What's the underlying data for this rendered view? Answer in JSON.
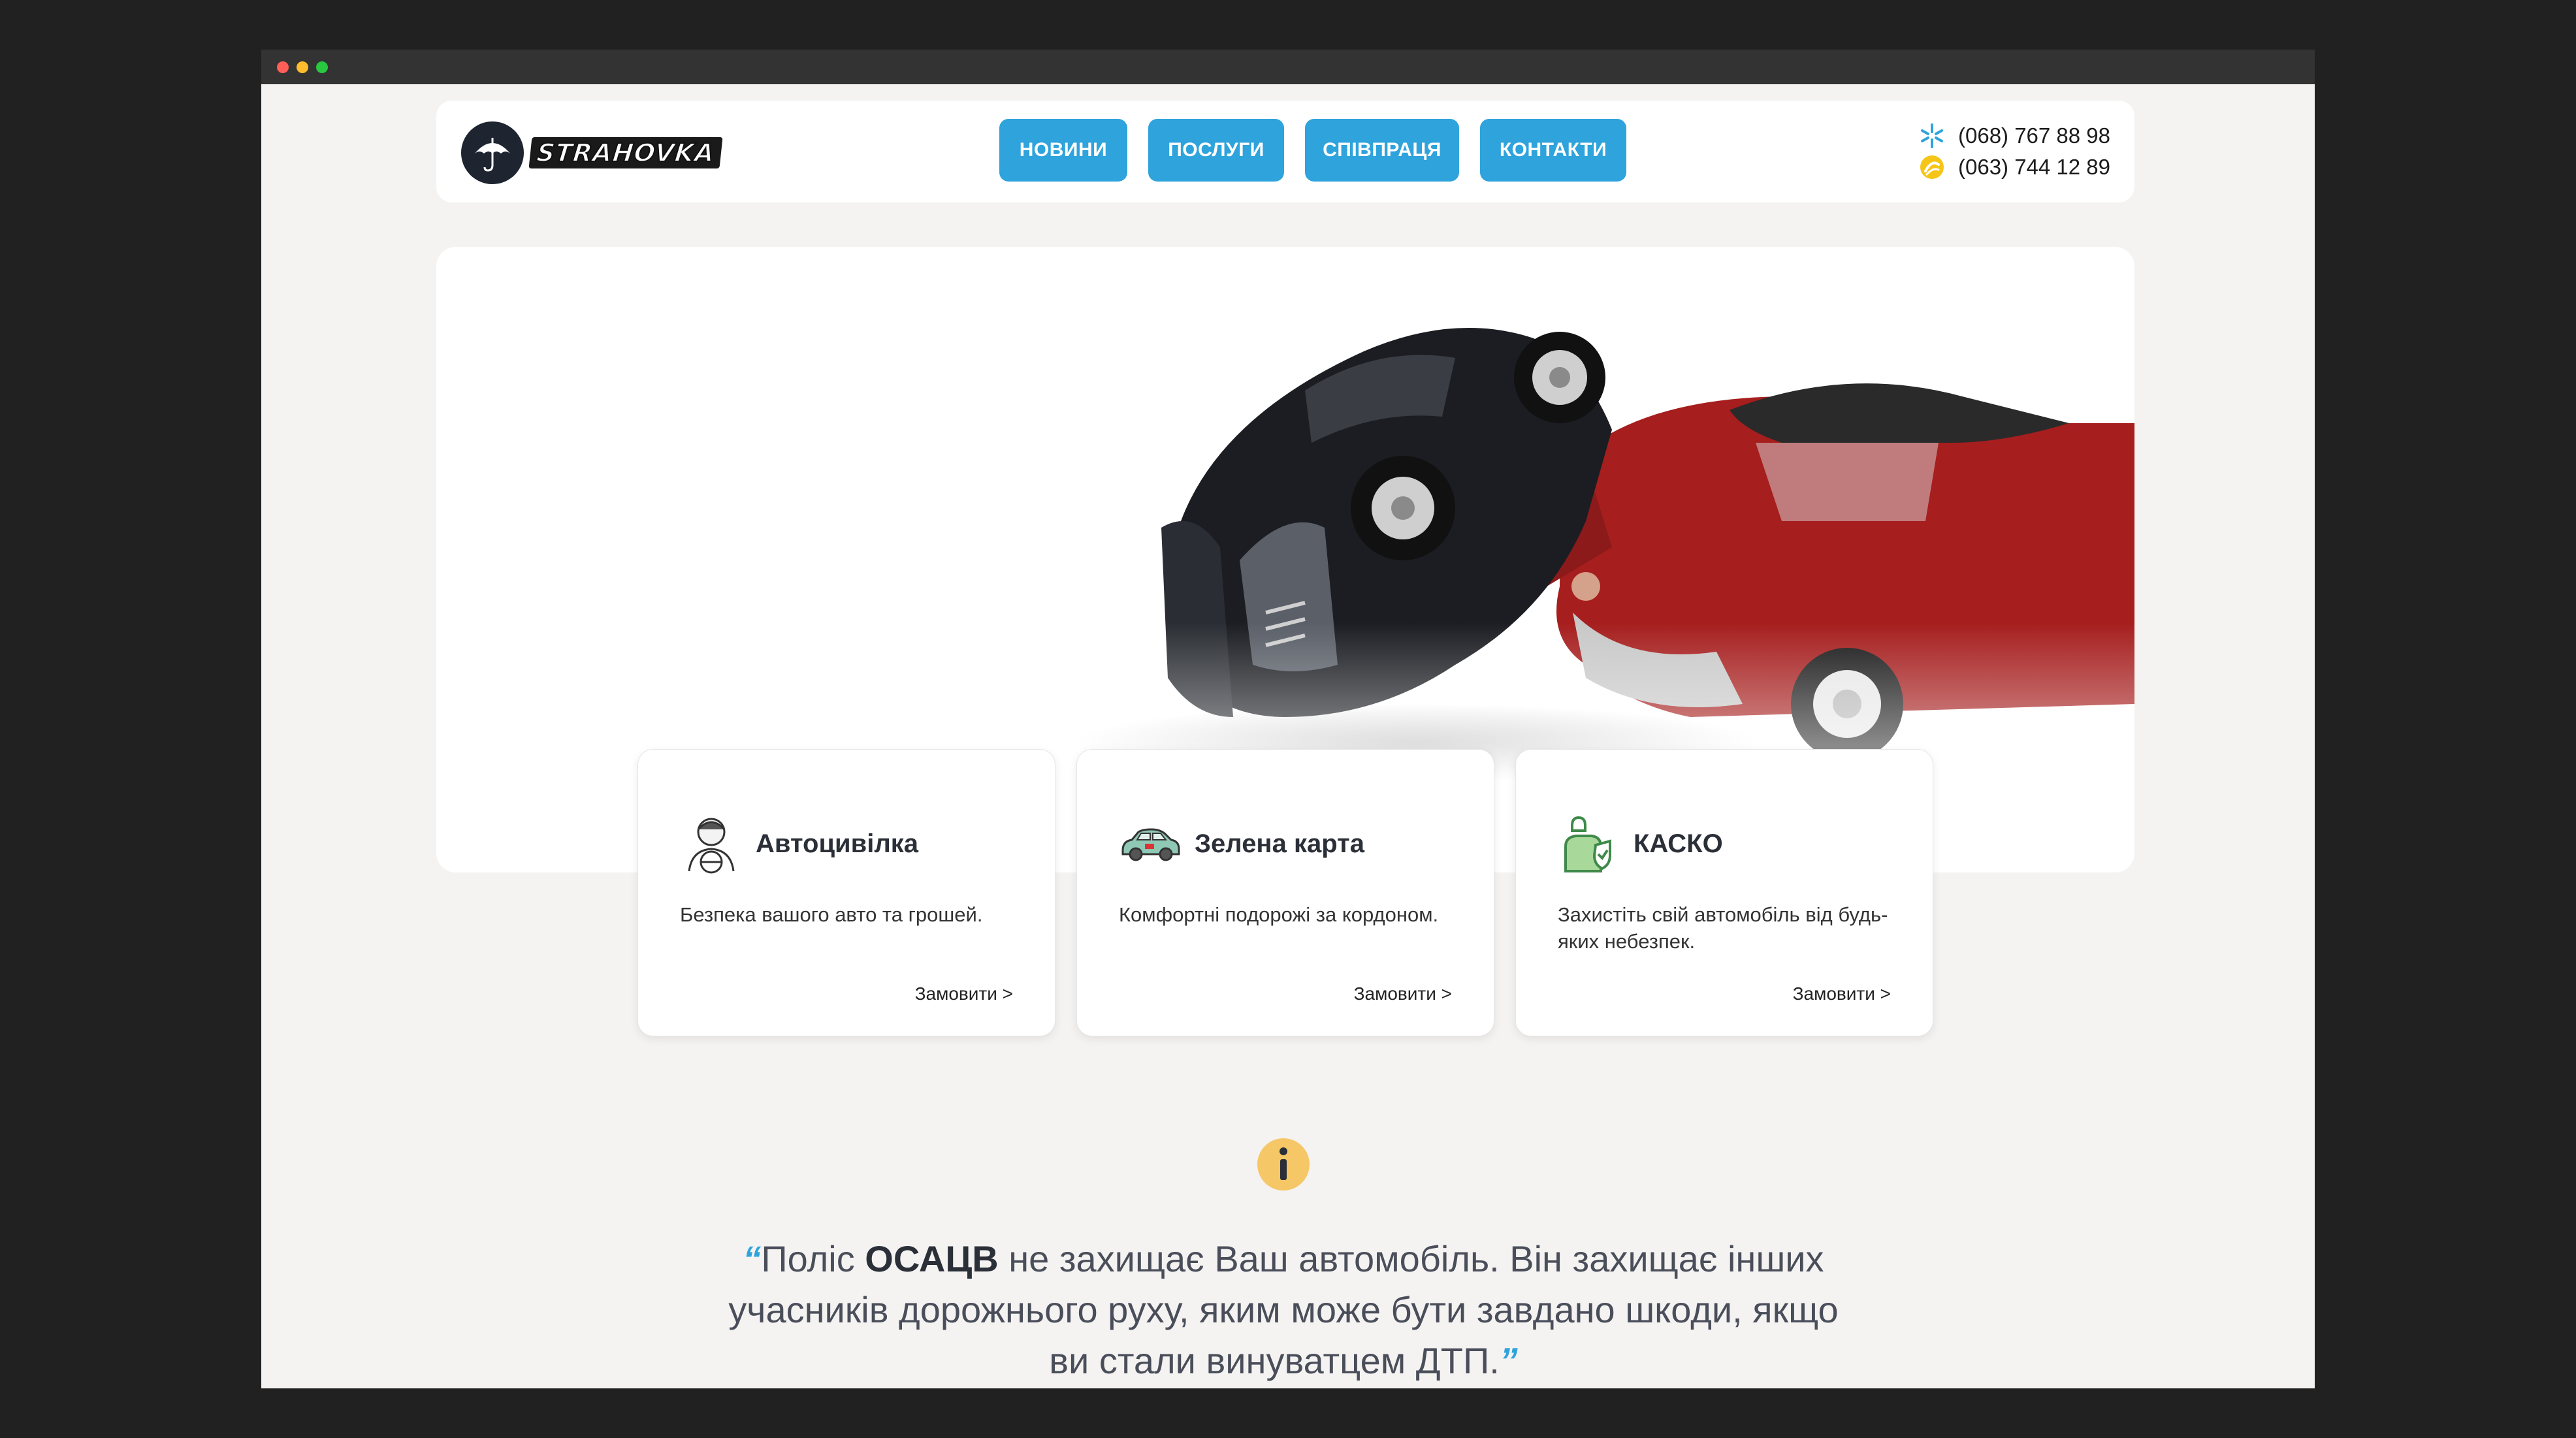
{
  "brand": {
    "name": "STRAHOVKA"
  },
  "nav": [
    {
      "label": "НОВИНИ"
    },
    {
      "label": "ПОСЛУГИ"
    },
    {
      "label": "СПІВПРАЦЯ"
    },
    {
      "label": "КОНТАКТИ"
    }
  ],
  "phones": [
    {
      "number": "(068) 767 88 98",
      "icon": "kyivstar-star-icon",
      "color": "#2ea3dc"
    },
    {
      "number": "(063) 744 12 89",
      "icon": "lifecell-icon",
      "color": "#f5c518"
    }
  ],
  "cards": [
    {
      "title": "Автоцивілка",
      "description": "Безпека вашого авто та грошей.",
      "link": "Замовити >",
      "icon": "driver-icon"
    },
    {
      "title": "Зелена карта",
      "description": "Комфортні подорожі за кордоном.",
      "link": "Замовити >",
      "icon": "car-icon"
    },
    {
      "title": "КАСКО",
      "description": "Захистіть свій автомобіль від будь-яких небезпек.",
      "link": "Замовити >",
      "icon": "protected-person-icon"
    }
  ],
  "info": {
    "icon": "info-icon",
    "open_quote": "“",
    "before": "Поліс ",
    "highlight": "ОСАЦВ",
    "after": " не захищає Ваш автомобіль. Він захищає інших учасників дорожнього руху, яким може бути завдано шкоди, якщо ви стали винуватцем ДТП.",
    "close_quote": "”"
  },
  "colors": {
    "accent": "#2ea3dc",
    "background": "#f4f3f1",
    "info_yellow": "#f6c766",
    "car_red": "#a61e1e",
    "car_black": "#1b1d22"
  }
}
